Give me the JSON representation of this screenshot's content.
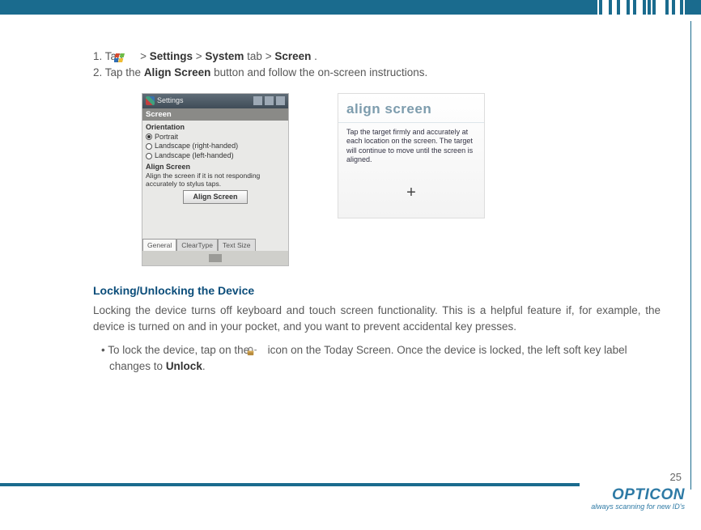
{
  "steps": {
    "one_prefix": "1. Tap ",
    "one_gt1": " > ",
    "one_settings": "Settings",
    "one_gt2": " > ",
    "one_system": "System",
    "one_tab": " tab > ",
    "one_screen": "Screen",
    "one_end": ".",
    "two_prefix": "2. Tap the ",
    "two_align": "Align Screen",
    "two_rest": " button and follow the on-screen instructions."
  },
  "shot1": {
    "titlebar": "Settings",
    "tab_header": "Screen",
    "orientation_label": "Orientation",
    "opt_portrait": "Portrait",
    "opt_land_r": "Landscape (right-handed)",
    "opt_land_l": "Landscape (left-handed)",
    "align_label": "Align Screen",
    "align_desc": "Align the screen if it is not responding accurately to stylus taps.",
    "align_btn": "Align Screen",
    "tab_general": "General",
    "tab_cleartype": "ClearType",
    "tab_textsize": "Text Size"
  },
  "shot2": {
    "title": "align screen",
    "text": "Tap the target firmly and accurately at each location on the screen. The target will continue to move until the screen is aligned.",
    "target": "+"
  },
  "section_heading": "Locking/Unlocking the Device",
  "section_body": "Locking the device turns off keyboard and touch screen functionality. This is a helpful feature if, for example, the device is turned on and in your pocket, and you want to prevent accidental key presses.",
  "bullet": {
    "pre": "• To lock the device, tap on the ",
    "post": " icon on the Today Screen. Once the device is locked, the left soft key label changes to ",
    "unlock": "Unlock",
    "end": "."
  },
  "page_number": "25",
  "brand": {
    "name": "OPTICON",
    "tagline": "always scanning for new ID's"
  }
}
